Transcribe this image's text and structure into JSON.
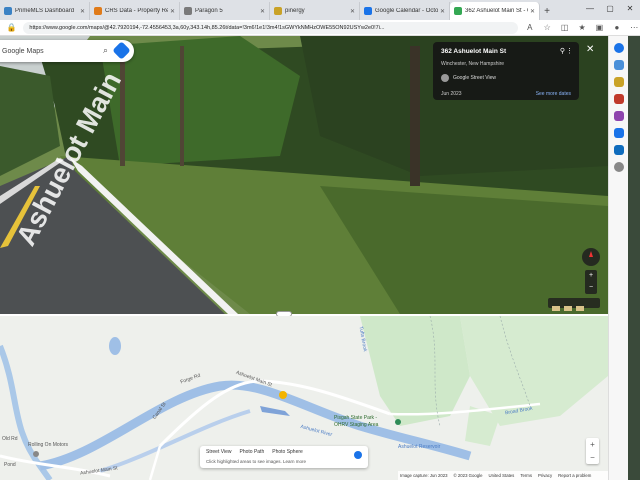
{
  "tabs": [
    {
      "label": "PrimeMLS Dashboard",
      "color": "#3b82c4"
    },
    {
      "label": "CRS Data - Property Repo",
      "color": "#e07b1a"
    },
    {
      "label": "Paragon 5",
      "color": "#7a7a7a"
    },
    {
      "label": "pinergy",
      "color": "#c9a227"
    },
    {
      "label": "Google Calendar - Octob",
      "color": "#1a73e8"
    },
    {
      "label": "362 Ashuelot Main St - G",
      "color": "#34a853",
      "active": true
    }
  ],
  "address_bar": {
    "url": "https://www.google.com/maps/@42.7920194,-72.4556453,3a,60y,343.14h,85.26t/data=!3m6!1e1!3m4!1sGWYkNMHzOWE55ON92USYw2e0!7i..."
  },
  "maps_search": {
    "label": "Google Maps"
  },
  "streetview_card": {
    "address": "362 Ashuelot Main St",
    "town": "Winchester, New Hampshire",
    "provider": "Google Street View",
    "date": "Jun 2023",
    "more_dates": "See more dates"
  },
  "street_sign": "Ashuelot Main",
  "map_labels": {
    "pisgah_park": "Pisgah State Park -",
    "ohrv": "OHRV Staging Area",
    "rolling": "Rolling On Motors",
    "ashuelot_river": "Ashuelot River",
    "ashuelot_reservoir": "Ashuelot Reservoir",
    "broad_brook": "Broad Brook",
    "tufts_brook": "Tufts Brook",
    "canal_st": "Canal St",
    "forge_rd": "Forge Rd",
    "old_rd": "Old Rd",
    "ashuelot_main_st": "Ashuelot Main St",
    "pond": "Pond"
  },
  "map_legend": {
    "street_view": "Street View",
    "photo_path": "Photo Path",
    "photo_sphere": "Photo Sphere",
    "hint": "Click highlighted areas to see images. Learn more"
  },
  "attribution": [
    "Image capture: Jun 2023",
    "© 2023 Google",
    "United States",
    "Terms",
    "Privacy",
    "Report a problem"
  ]
}
